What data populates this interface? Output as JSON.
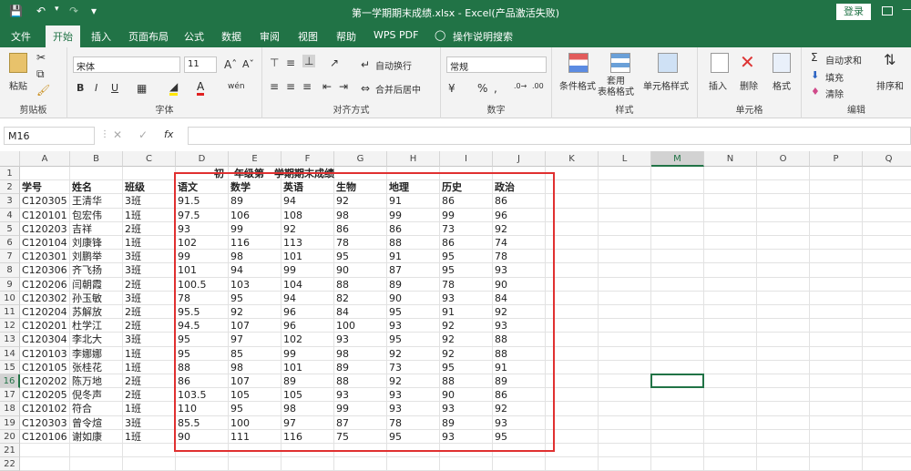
{
  "titlebar": {
    "title": "第一学期期末成绩.xlsx - Excel(产品激活失败)",
    "login_label": "登录"
  },
  "tabs": [
    "文件",
    "开始",
    "插入",
    "页面布局",
    "公式",
    "数据",
    "审阅",
    "视图",
    "帮助",
    "WPS PDF",
    "操作说明搜索"
  ],
  "ribbon": {
    "clipboard": {
      "paste": "粘贴",
      "label": "剪贴板"
    },
    "font": {
      "name": "宋体",
      "size": "11",
      "label": "字体",
      "bold": "B",
      "italic": "I",
      "underline": "U"
    },
    "align": {
      "wrap": "自动换行",
      "merge": "合并后居中",
      "label": "对齐方式"
    },
    "number": {
      "format": "常规",
      "label": "数字",
      "percent": "%",
      "comma": ","
    },
    "styles": {
      "conditional": "条件格式",
      "table": "套用\n表格格式",
      "cell": "单元格样式",
      "label": "样式"
    },
    "cells": {
      "insert": "插入",
      "delete": "删除",
      "format": "格式",
      "label": "单元格"
    },
    "editing": {
      "autosum": "自动求和",
      "fill": "填充",
      "clear": "清除",
      "sort": "排序和",
      "label": "编辑"
    }
  },
  "formula_bar": {
    "cell_ref": "M16",
    "fx": "fx",
    "content": ""
  },
  "columns": [
    "A",
    "B",
    "C",
    "D",
    "E",
    "F",
    "G",
    "H",
    "I",
    "J",
    "K",
    "L",
    "M",
    "N",
    "O",
    "P",
    "Q"
  ],
  "rows": [
    "1",
    "2",
    "3",
    "4",
    "5",
    "6",
    "7",
    "8",
    "9",
    "10",
    "11",
    "12",
    "13",
    "14",
    "15",
    "16",
    "17",
    "18",
    "19",
    "20",
    "21",
    "22"
  ],
  "sheet": {
    "title_row": "初一年级第一学期期末成绩",
    "headers": [
      "学号",
      "姓名",
      "班级",
      "语文",
      "数学",
      "英语",
      "生物",
      "地理",
      "历史",
      "政治"
    ],
    "data": [
      [
        "C120305",
        "王清华",
        "3班",
        "91.5",
        "89",
        "94",
        "92",
        "91",
        "86",
        "86"
      ],
      [
        "C120101",
        "包宏伟",
        "1班",
        "97.5",
        "106",
        "108",
        "98",
        "99",
        "99",
        "96"
      ],
      [
        "C120203",
        "吉祥",
        "2班",
        "93",
        "99",
        "92",
        "86",
        "86",
        "73",
        "92"
      ],
      [
        "C120104",
        "刘康锋",
        "1班",
        "102",
        "116",
        "113",
        "78",
        "88",
        "86",
        "74"
      ],
      [
        "C120301",
        "刘鹏举",
        "3班",
        "99",
        "98",
        "101",
        "95",
        "91",
        "95",
        "78"
      ],
      [
        "C120306",
        "齐飞扬",
        "3班",
        "101",
        "94",
        "99",
        "90",
        "87",
        "95",
        "93"
      ],
      [
        "C120206",
        "闫朝霞",
        "2班",
        "100.5",
        "103",
        "104",
        "88",
        "89",
        "78",
        "90"
      ],
      [
        "C120302",
        "孙玉敏",
        "3班",
        "78",
        "95",
        "94",
        "82",
        "90",
        "93",
        "84"
      ],
      [
        "C120204",
        "苏解放",
        "2班",
        "95.5",
        "92",
        "96",
        "84",
        "95",
        "91",
        "92"
      ],
      [
        "C120201",
        "杜学江",
        "2班",
        "94.5",
        "107",
        "96",
        "100",
        "93",
        "92",
        "93"
      ],
      [
        "C120304",
        "李北大",
        "3班",
        "95",
        "97",
        "102",
        "93",
        "95",
        "92",
        "88"
      ],
      [
        "C120103",
        "李娜娜",
        "1班",
        "95",
        "85",
        "99",
        "98",
        "92",
        "92",
        "88"
      ],
      [
        "C120105",
        "张桂花",
        "1班",
        "88",
        "98",
        "101",
        "89",
        "73",
        "95",
        "91"
      ],
      [
        "C120202",
        "陈万地",
        "2班",
        "86",
        "107",
        "89",
        "88",
        "92",
        "88",
        "89"
      ],
      [
        "C120205",
        "倪冬声",
        "2班",
        "103.5",
        "105",
        "105",
        "93",
        "93",
        "90",
        "86"
      ],
      [
        "C120102",
        "符合",
        "1班",
        "110",
        "95",
        "98",
        "99",
        "93",
        "93",
        "92"
      ],
      [
        "C120303",
        "曾令煊",
        "3班",
        "85.5",
        "100",
        "97",
        "87",
        "78",
        "89",
        "93"
      ],
      [
        "C120106",
        "谢如康",
        "1班",
        "90",
        "111",
        "116",
        "75",
        "95",
        "93",
        "95"
      ]
    ]
  },
  "colors": {
    "accent": "#217346",
    "highlight_box": "#e03030",
    "selection": "#217346"
  }
}
